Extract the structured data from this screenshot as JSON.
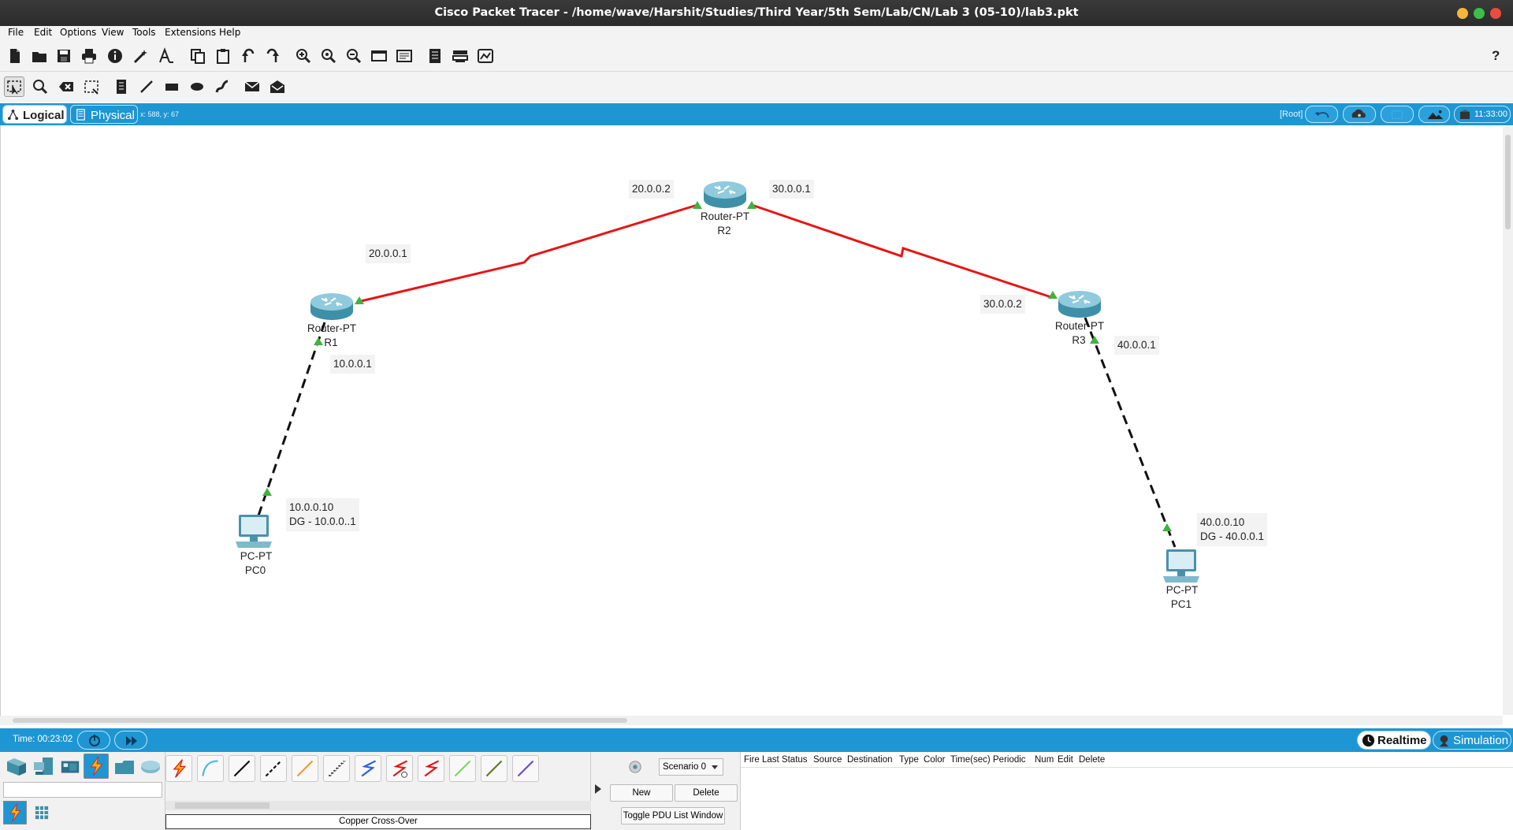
{
  "window": {
    "title": "Cisco Packet Tracer - /home/wave/Harshit/Studies/Third Year/5th Sem/Lab/CN/Lab 3 (05-10)/lab3.pkt",
    "buttons": {
      "minimize_color": "#f4b73a",
      "maximize_color": "#3dbd49",
      "close_color": "#ea4c3f"
    }
  },
  "menu": [
    "File",
    "Edit",
    "Options",
    "View",
    "Tools",
    "Extensions",
    "Help"
  ],
  "toolbar": {
    "main_icons": [
      "new-icon",
      "open-icon",
      "save-icon",
      "print-icon",
      "info-icon",
      "wizard-icon",
      "font-icon",
      "copy-icon",
      "paste-icon",
      "undo-icon",
      "redo-icon",
      "zoom-in-icon",
      "zoom-reset-icon",
      "zoom-out-icon",
      "drawing-palette-icon",
      "custom-device-icon",
      "notes-icon",
      "device-list-icon",
      "viewport-icon"
    ],
    "help": "?",
    "edit_icons": [
      "select-icon",
      "inspect-icon",
      "delete-icon",
      "resize-icon",
      "note-icon",
      "line-icon",
      "rectangle-icon",
      "ellipse-icon",
      "freeform-icon",
      "simple-pdu-icon",
      "complex-pdu-icon"
    ]
  },
  "modebar": {
    "logical_label": "Logical",
    "physical_label": "Physical",
    "coords": "x: 588, y: 67",
    "root_label": "[Root]",
    "clock": "11:33:00"
  },
  "topology": {
    "devices": [
      {
        "id": "R2",
        "model": "Router-PT",
        "name": "R2",
        "type": "router"
      },
      {
        "id": "R1",
        "model": "Router-PT",
        "name": "R1",
        "type": "router"
      },
      {
        "id": "R3",
        "model": "Router-PT",
        "name": "R3",
        "type": "router"
      },
      {
        "id": "PC0",
        "model": "PC-PT",
        "name": "PC0",
        "type": "pc"
      },
      {
        "id": "PC1",
        "model": "PC-PT",
        "name": "PC1",
        "type": "pc"
      }
    ],
    "links": [
      {
        "from": "R1",
        "to": "R2",
        "type": "serial",
        "color": "#e81414"
      },
      {
        "from": "R2",
        "to": "R3",
        "type": "serial",
        "color": "#e81414"
      },
      {
        "from": "R1",
        "to": "PC0",
        "type": "copper-cross-over",
        "color": "#111111"
      },
      {
        "from": "R3",
        "to": "PC1",
        "type": "copper-cross-over",
        "color": "#111111"
      }
    ],
    "link_status_color": "#3fb23f",
    "notes": {
      "r2_left": "20.0.0.2",
      "r2_right": "30.0.0.1",
      "r1_serial": "20.0.0.1",
      "r1_fa": "10.0.0.1",
      "r3_serial": "30.0.0.2",
      "r3_fa": "40.0.0.1",
      "pc0_ip": "10.0.0.10",
      "pc0_dg": "DG - 10.0.0..1",
      "pc1_ip": "40.0.0.10",
      "pc1_dg": "DG - 40.0.0.1"
    }
  },
  "timebar": {
    "time": "Time: 00:23:02",
    "realtime_label": "Realtime",
    "simulation_label": "Simulation"
  },
  "bottom": {
    "device_category_icons": [
      "network-devices-icon",
      "end-devices-icon",
      "components-icon",
      "connections-icon",
      "miscellaneous-icon",
      "multiuser-icon"
    ],
    "connection_icons": [
      "automatic-connection-icon",
      "console-cable-icon",
      "copper-straight-through-icon",
      "copper-cross-over-icon",
      "fiber-icon",
      "phone-cable-icon",
      "coaxial-icon",
      "serial-dce-icon",
      "serial-dte-icon",
      "octal-cable-icon",
      "iot-custom-cable-icon",
      "usb-cable-icon"
    ],
    "selected_connection": "Copper Cross-Over",
    "scenario": "Scenario 0",
    "new_label": "New",
    "delete_label": "Delete",
    "toggle_label": "Toggle PDU List Window",
    "pdu_columns": [
      "Fire",
      "Last Status",
      "Source",
      "Destination",
      "Type",
      "Color",
      "Time(sec)",
      "Periodic",
      "Num",
      "Edit",
      "Delete"
    ]
  }
}
